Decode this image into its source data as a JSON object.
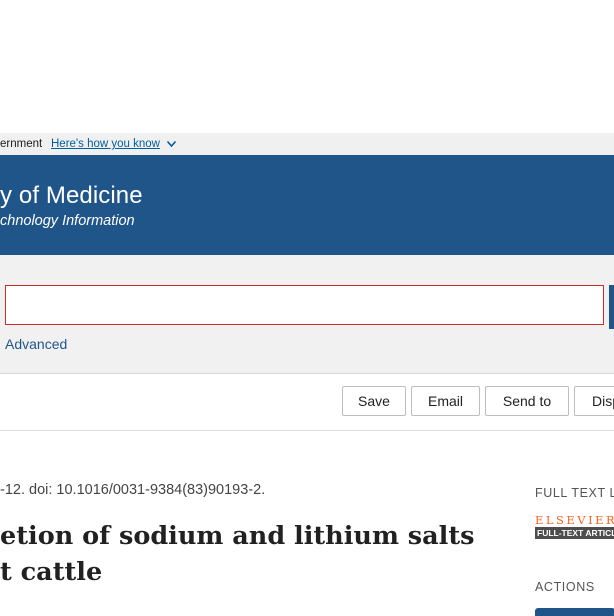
{
  "gov_banner": {
    "text": "ernment",
    "link": "Here's how you know"
  },
  "header": {
    "title": "y of Medicine",
    "subtitle": "chnology Information"
  },
  "search": {
    "value": "",
    "placeholder": "",
    "advanced_label": "Advanced"
  },
  "toolbar": {
    "save_label": "Save",
    "email_label": "Email",
    "send_to_label": "Send to",
    "display_label": "Disp"
  },
  "article": {
    "citation": "-12. doi: 10.1016/0031-9384(83)90193-2.",
    "title_line1": "etion of sodium and lithium salts",
    "title_line2": "t cattle"
  },
  "sidebar": {
    "full_text_heading": "FULL TEXT LIN",
    "publisher_logo_brand": "ELSEVIER",
    "publisher_logo_sub": "FULL-TEXT ARTICLE",
    "actions_heading": "ACTIONS"
  },
  "colors": {
    "header_bg": "#20558a",
    "link": "#005ea2",
    "search_border": "#cf2b2b",
    "elsevier_orange": "#f26522"
  },
  "icons": {
    "banner_toggle": "chevron-down-icon"
  }
}
